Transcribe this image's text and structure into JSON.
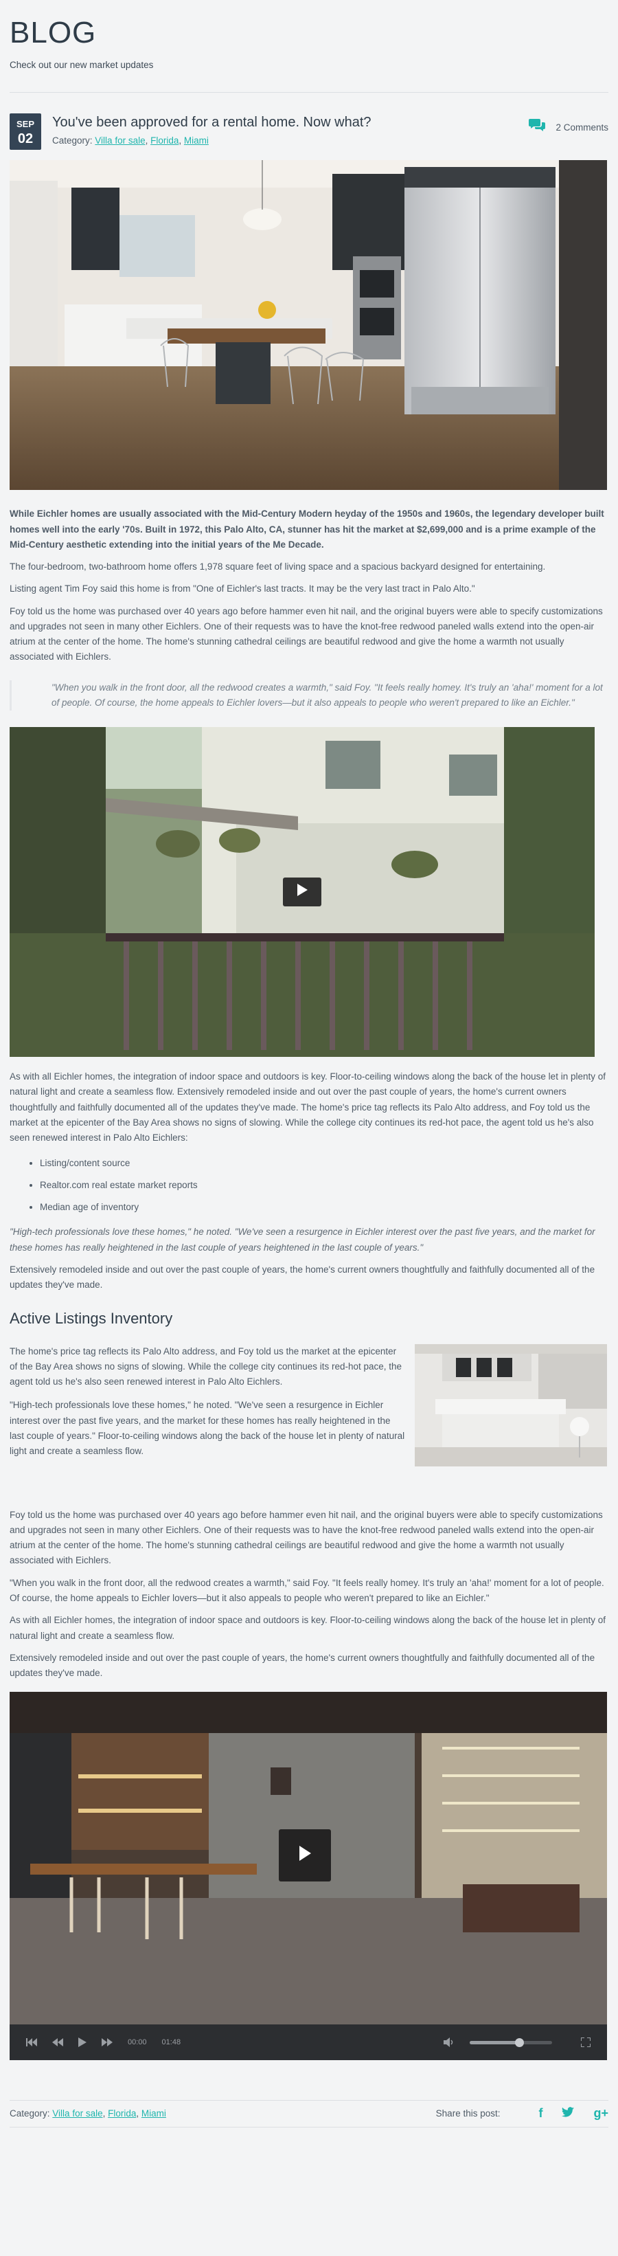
{
  "header": {
    "title": "BLOG",
    "subtitle": "Check out our new market updates"
  },
  "post": {
    "date_month": "SEP",
    "date_day": "02",
    "title": "You've been approved for a rental home. Now what?",
    "category_label": "Category:",
    "categories": [
      "Villa for sale",
      "Florida",
      "Miami"
    ],
    "comments": "2 Comments"
  },
  "content": {
    "lead": "While Eichler homes are usually associated with the Mid-Century Modern heyday of the 1950s and 1960s, the legendary developer built homes well into the early '70s. Built in 1972, this Palo Alto, CA, stunner has hit the market at $2,699,000 and is a prime example of the Mid-Century aesthetic extending into the initial years of the Me Decade.",
    "p1": "The four-bedroom, two-bathroom home offers 1,978 square feet of living space and a spacious backyard designed for entertaining.",
    "p2": "Listing agent Tim Foy said this home is from \"One of Eichler's last tracts. It may be the very last tract in Palo Alto.\"",
    "p3": "Foy told us the home was purchased over 40 years ago before hammer even hit nail, and the original buyers were able to specify customizations and upgrades not seen in many other Eichlers. One of their requests was to have the knot-free redwood paneled walls extend into the open-air atrium at the center of the home. The home's stunning cathedral ceilings are beautiful redwood and give the home a warmth not usually associated with Eichlers.",
    "quote1": "\"When you walk in the front door, all the redwood creates a warmth,\" said Foy. \"It feels really homey. It's truly an 'aha!' moment for a lot of people. Of course, the home appeals to Eichler lovers—but it also appeals to people who weren't prepared to like an Eichler.\"",
    "p4": "As with all Eichler homes, the integration of indoor space and outdoors is key. Floor-to-ceiling windows along the back of the house let in plenty of natural light and create a seamless flow. Extensively remodeled inside and out over the past couple of years, the home's current owners thoughtfully and faithfully documented all of the updates they've made. The home's price tag reflects its Palo Alto address, and Foy told us the market at the epicenter of the Bay Area shows no signs of slowing. While the college city continues its red-hot pace, the agent told us he's also seen renewed interest in Palo Alto Eichlers:",
    "bullets": [
      "Listing/content source",
      "Realtor.com real estate market reports",
      "Median age of inventory"
    ],
    "quote2": "\"High-tech professionals love these homes,\" he noted. \"We've seen a resurgence in Eichler interest over the past five years, and the market for these homes has really heightened in the last couple of years heightened in the last couple of years.\"",
    "p5": "Extensively remodeled inside and out over the past couple of years, the home's current owners thoughtfully and faithfully documented all of the updates they've made.",
    "section_title": "Active Listings Inventory",
    "f1": "The home's price tag reflects its Palo Alto address, and Foy told us the market at the epicenter of the Bay Area shows no signs of slowing. While the college city continues its red-hot pace, the agent told us he's also seen renewed interest in Palo Alto Eichlers.",
    "f2": "\"High-tech professionals love these homes,\" he noted. \"We've seen a resurgence in Eichler interest over the past five years, and the market for these homes has really heightened in the last couple of years.\" Floor-to-ceiling windows along the back of the house let in plenty of natural light and create a seamless flow.",
    "p6": "Foy told us the home was purchased over 40 years ago before hammer even hit nail, and the original buyers were able to specify customizations and upgrades not seen in many other Eichlers. One of their requests was to have the knot-free redwood paneled walls extend into the open-air atrium at the center of the home. The home's stunning cathedral ceilings are beautiful redwood and give the home a warmth not usually associated with Eichlers.",
    "p7": "\"When you walk in the front door, all the redwood creates a warmth,\" said Foy. \"It feels really homey. It's truly an 'aha!' moment for a lot of people. Of course, the home appeals to Eichler lovers—but it also appeals to people who weren't prepared to like an Eichler.\"",
    "p8": "As with all Eichler homes, the integration of indoor space and outdoors is key. Floor-to-ceiling windows along the back of the house let in plenty of natural light and create a seamless flow.",
    "p9": "Extensively remodeled inside and out over the past couple of years, the home's current owners thoughtfully and faithfully documented all of the updates they've made."
  },
  "player": {
    "current_time": "00:00",
    "duration": "01:48",
    "volume": 0.6
  },
  "footer": {
    "category_label": "Category:",
    "categories": [
      "Villa for sale",
      "Florida",
      "Miami"
    ],
    "share_label": "Share this post:",
    "social": [
      "facebook-icon",
      "twitter-icon",
      "google-plus-icon"
    ]
  },
  "colors": {
    "accent": "#1fb5ad",
    "heading": "#2f3c48",
    "text": "#4e5a66",
    "date_box": "#344455",
    "background": "#f3f4f5"
  }
}
